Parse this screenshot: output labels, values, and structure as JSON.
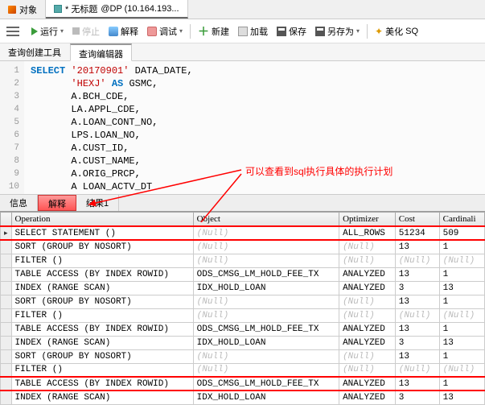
{
  "topTabs": {
    "objects": "对象",
    "untitled": "* 无标题",
    "conn": "@DP (10.164.193..."
  },
  "toolbar": {
    "run": "运行",
    "stop": "停止",
    "explain": "解释",
    "debug": "调试",
    "new": "新建",
    "load": "加载",
    "save": "保存",
    "saveAs": "另存为",
    "beautify": "美化",
    "sql": "SQ"
  },
  "subTabs": {
    "builder": "查询创建工具",
    "editor": "查询编辑器"
  },
  "code": {
    "lines": [
      {
        "n": "1",
        "html": "<span class='kw'>SELECT</span> <span class='str'>'20170901'</span> DATA_DATE,"
      },
      {
        "n": "2",
        "html": "       <span class='str'>'HEXJ'</span> <span class='kw'>AS</span> GSMC,"
      },
      {
        "n": "3",
        "html": "       A.BCH_CDE,"
      },
      {
        "n": "4",
        "html": "       LA.APPL_CDE,"
      },
      {
        "n": "5",
        "html": "       A.LOAN_CONT_NO,"
      },
      {
        "n": "6",
        "html": "       LPS.LOAN_NO,"
      },
      {
        "n": "7",
        "html": "       A.CUST_ID,"
      },
      {
        "n": "8",
        "html": "       A.CUST_NAME,"
      },
      {
        "n": "9",
        "html": "       A.ORIG_PRCP,"
      },
      {
        "n": "10",
        "html": "       A LOAN_ACTV_DT"
      }
    ]
  },
  "annotation": "可以查看到sql执行具体的执行计划",
  "bottomTabs": {
    "info": "信息",
    "explain": "解释",
    "result1": "结果1"
  },
  "gridHeaders": [
    "Operation",
    "Object",
    "Optimizer",
    "Cost",
    "Cardinali"
  ],
  "gridRows": [
    {
      "op": "SELECT STATEMENT ()",
      "obj": "(Null)",
      "opt": "ALL_ROWS",
      "cost": "51234",
      "card": "509",
      "hl": true,
      "cur": true
    },
    {
      "op": " SORT (GROUP BY NOSORT)",
      "obj": "(Null)",
      "opt": "(Null)",
      "cost": "13",
      "card": "1"
    },
    {
      "op": "  FILTER ()",
      "obj": "(Null)",
      "opt": "(Null)",
      "cost": "(Null)",
      "card": "(Null)"
    },
    {
      "op": "   TABLE ACCESS (BY INDEX ROWID)",
      "obj": "ODS_CMSG_LM_HOLD_FEE_TX",
      "opt": "ANALYZED",
      "cost": "13",
      "card": "1"
    },
    {
      "op": "    INDEX (RANGE SCAN)",
      "obj": "IDX_HOLD_LOAN",
      "opt": "ANALYZED",
      "cost": "3",
      "card": "13"
    },
    {
      "op": " SORT (GROUP BY NOSORT)",
      "obj": "(Null)",
      "opt": "(Null)",
      "cost": "13",
      "card": "1"
    },
    {
      "op": "  FILTER ()",
      "obj": "(Null)",
      "opt": "(Null)",
      "cost": "(Null)",
      "card": "(Null)"
    },
    {
      "op": "   TABLE ACCESS (BY INDEX ROWID)",
      "obj": "ODS_CMSG_LM_HOLD_FEE_TX",
      "opt": "ANALYZED",
      "cost": "13",
      "card": "1"
    },
    {
      "op": "    INDEX (RANGE SCAN)",
      "obj": "IDX_HOLD_LOAN",
      "opt": "ANALYZED",
      "cost": "3",
      "card": "13"
    },
    {
      "op": " SORT (GROUP BY NOSORT)",
      "obj": "(Null)",
      "opt": "(Null)",
      "cost": "13",
      "card": "1"
    },
    {
      "op": "  FILTER ()",
      "obj": "(Null)",
      "opt": "(Null)",
      "cost": "(Null)",
      "card": "(Null)"
    },
    {
      "op": "   TABLE ACCESS (BY INDEX ROWID)",
      "obj": "ODS_CMSG_LM_HOLD_FEE_TX",
      "opt": "ANALYZED",
      "cost": "13",
      "card": "1",
      "hl": true
    },
    {
      "op": "    INDEX (RANGE SCAN)",
      "obj": "IDX_HOLD_LOAN",
      "opt": "ANALYZED",
      "cost": "3",
      "card": "13"
    }
  ]
}
